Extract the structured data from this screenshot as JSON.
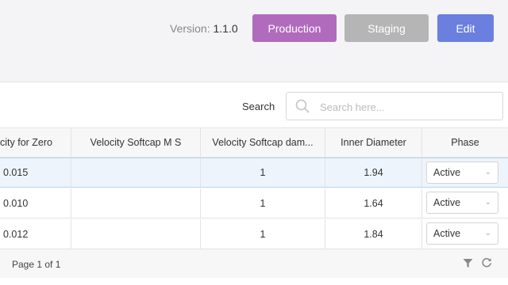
{
  "header": {
    "version_label": "Version:",
    "version_value": "1.1.0",
    "production_label": "Production",
    "staging_label": "Staging",
    "edit_label": "Edit"
  },
  "search": {
    "label": "Search",
    "placeholder": "Search here..."
  },
  "table": {
    "columns": [
      "city for Zero",
      "Velocity Softcap M S",
      "Velocity Softcap dam...",
      "Inner Diameter",
      "Phase"
    ],
    "rows": [
      {
        "c0": "0.015",
        "c1": "",
        "c2": "1",
        "c3": "1.94",
        "phase": "Active"
      },
      {
        "c0": "0.010",
        "c1": "",
        "c2": "1",
        "c3": "1.64",
        "phase": "Active"
      },
      {
        "c0": "0.012",
        "c1": "",
        "c2": "1",
        "c3": "1.84",
        "phase": "Active"
      }
    ]
  },
  "footer": {
    "page_info": "Page 1 of 1"
  },
  "colors": {
    "production": "#b06bbd",
    "staging": "#b5b5b5",
    "edit": "#6a7fde",
    "selected_row": "#eef4fc"
  },
  "icons": [
    "search-icon",
    "chevron-down-icon",
    "filter-icon",
    "refresh-icon"
  ]
}
